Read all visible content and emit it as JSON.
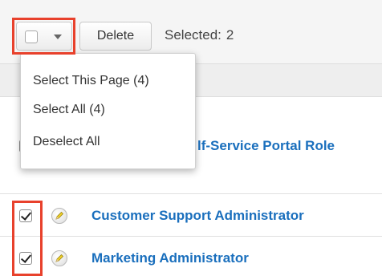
{
  "toolbar": {
    "delete_label": "Delete",
    "selected_label": "Selected:",
    "selected_count": "2"
  },
  "dropdown": {
    "items": [
      {
        "label": "Select This Page (4)"
      },
      {
        "label": "Select All (4)"
      },
      {
        "label": "Deselect All"
      }
    ]
  },
  "rows": [
    {
      "name": "lf-Service Portal Role",
      "checked": false
    },
    {
      "name": "Customer Support Administrator",
      "checked": true
    },
    {
      "name": "Marketing Administrator",
      "checked": true
    }
  ],
  "colors": {
    "link": "#1a6fbd",
    "highlight": "#e8412c"
  },
  "icons": {
    "edit": "pencil-icon",
    "caret": "caret-down-icon",
    "checkbox": "checkbox-icon"
  }
}
